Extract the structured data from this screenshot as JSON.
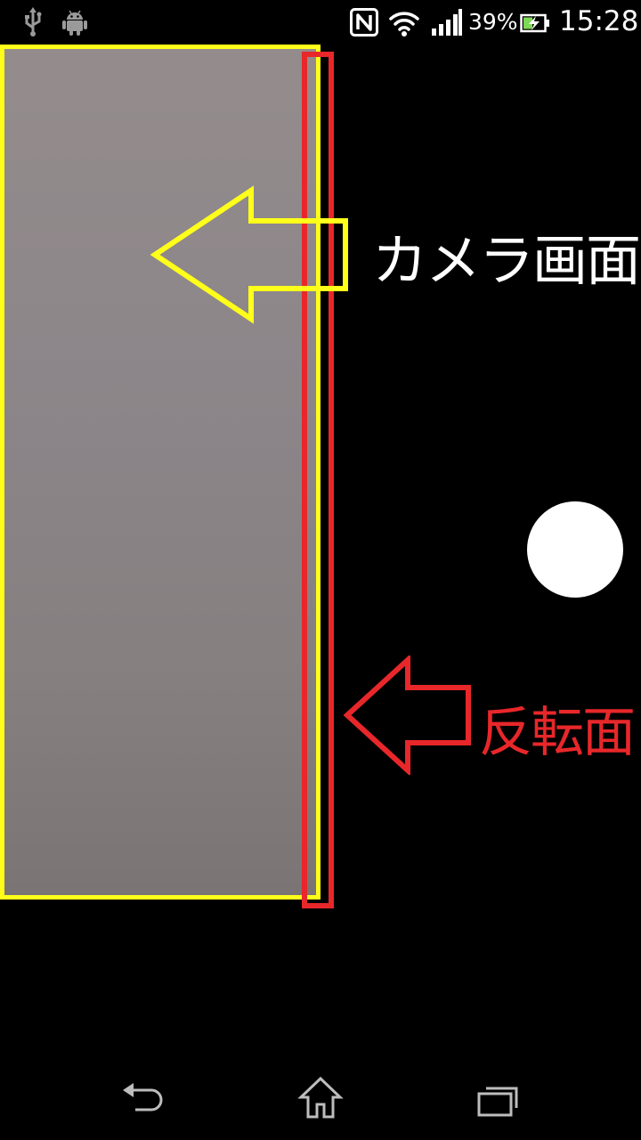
{
  "status_bar": {
    "battery_percent": "39%",
    "time": "15:28",
    "left_icons": [
      "usb-icon",
      "android-icon"
    ],
    "right_icons": [
      "nfc-icon",
      "wifi-icon",
      "signal-icon",
      "battery-charging-icon"
    ]
  },
  "annotations": {
    "camera_label": "カメラ画面",
    "flip_label": "反転面"
  },
  "colors": {
    "camera_outline": "#ffff1a",
    "flip_outline": "#e8272a",
    "background": "#000000",
    "shutter": "#ffffff"
  },
  "nav_bar": {
    "buttons": [
      "back-icon",
      "home-icon",
      "recent-apps-icon"
    ]
  }
}
